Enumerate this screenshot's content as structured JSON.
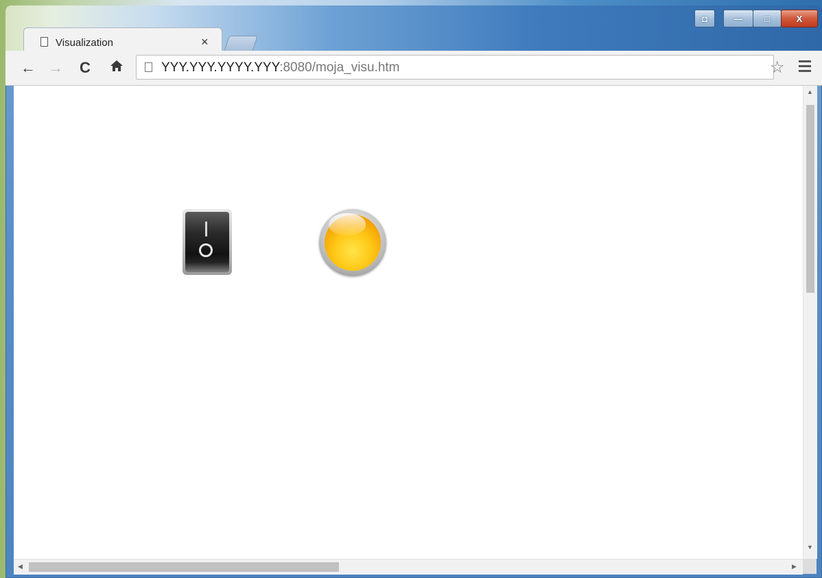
{
  "window": {
    "controls": {
      "user": "◘",
      "minimize": "—",
      "maximize": "□",
      "close": "X"
    }
  },
  "tab": {
    "title": "Visualization",
    "close": "×"
  },
  "toolbar": {
    "back": "←",
    "forward": "→",
    "reload": "C",
    "home": "🏠",
    "url_host": "YYY.YYY.YYYY.YYY",
    "url_path": ":8080/moja_visu.htm",
    "star": "☆"
  },
  "scrollbars": {
    "up": "▲",
    "down": "▼",
    "left": "◀",
    "right": "▶"
  },
  "visu": {
    "switch_on_label": "I",
    "switch_off_label": "O",
    "lamp_color": "#ffc817"
  }
}
